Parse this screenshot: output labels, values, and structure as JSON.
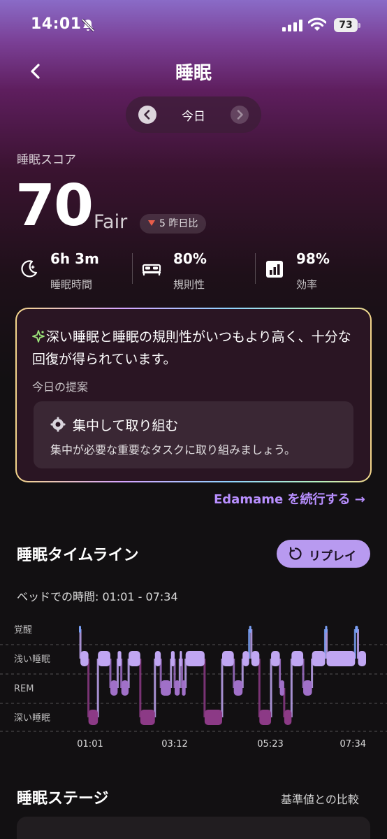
{
  "status_bar": {
    "time": "14:01",
    "battery": "73"
  },
  "header": {
    "title": "睡眠"
  },
  "date_nav": {
    "label": "今日"
  },
  "score": {
    "label": "睡眠スコア",
    "value": "70",
    "grade": "Fair",
    "delta_text": "5 昨日比"
  },
  "metrics": [
    {
      "value": "6h 3m",
      "label": "睡眠時間",
      "icon": "moon-icon"
    },
    {
      "value": "80%",
      "label": "規則性",
      "icon": "bed-icon"
    },
    {
      "value": "98%",
      "label": "効率",
      "icon": "efficiency-icon"
    }
  ],
  "insight": {
    "text": "深い睡眠と睡眠の規則性がいつもより高く、十分な回復が得られています。",
    "suggestion_label": "今日の提案",
    "suggestion_title": "集中して取り組む",
    "suggestion_desc": "集中が必要な重要なタスクに取り組みましょう。"
  },
  "continue_link": "Edamame を続行する →",
  "timeline": {
    "title": "睡眠タイムライン",
    "replay_label": "リプレイ",
    "bed_time": "ベッドでの時間: 01:01 - 07:34"
  },
  "stages": {
    "title": "睡眠ステージ",
    "compare_link": "基準値との比較"
  },
  "colors": {
    "accent": "#b89af0",
    "awake": "#7aa0f5",
    "light": "#c0a6f2",
    "rem": "#a070c8",
    "deep": "#8c3a86",
    "delta_down": "#e85d4a"
  },
  "chart_data": {
    "type": "hypnogram",
    "stages": [
      "覚醒",
      "浅い睡眠",
      "REM",
      "深い睡眠"
    ],
    "x_ticks": [
      "01:01",
      "03:12",
      "05:23",
      "07:34"
    ],
    "x_range_minutes": [
      0,
      393
    ],
    "segments": [
      {
        "stage": "覚醒",
        "start": 0,
        "end": 2
      },
      {
        "stage": "浅い睡眠",
        "start": 2,
        "end": 13
      },
      {
        "stage": "深い睡眠",
        "start": 13,
        "end": 26
      },
      {
        "stage": "浅い睡眠",
        "start": 26,
        "end": 43
      },
      {
        "stage": "REM",
        "start": 43,
        "end": 53
      },
      {
        "stage": "浅い睡眠",
        "start": 53,
        "end": 58
      },
      {
        "stage": "REM",
        "start": 58,
        "end": 68
      },
      {
        "stage": "浅い睡眠",
        "start": 68,
        "end": 84
      },
      {
        "stage": "深い睡眠",
        "start": 84,
        "end": 104
      },
      {
        "stage": "浅い睡眠",
        "start": 104,
        "end": 112
      },
      {
        "stage": "REM",
        "start": 112,
        "end": 126
      },
      {
        "stage": "浅い睡眠",
        "start": 126,
        "end": 131
      },
      {
        "stage": "REM",
        "start": 131,
        "end": 138
      },
      {
        "stage": "浅い睡眠",
        "start": 138,
        "end": 141
      },
      {
        "stage": "REM",
        "start": 141,
        "end": 146
      },
      {
        "stage": "浅い睡眠",
        "start": 146,
        "end": 172
      },
      {
        "stage": "深い睡眠",
        "start": 172,
        "end": 196
      },
      {
        "stage": "浅い睡眠",
        "start": 196,
        "end": 212
      },
      {
        "stage": "REM",
        "start": 212,
        "end": 224
      },
      {
        "stage": "浅い睡眠",
        "start": 224,
        "end": 233
      },
      {
        "stage": "覚醒",
        "start": 233,
        "end": 236
      },
      {
        "stage": "浅い睡眠",
        "start": 236,
        "end": 247
      },
      {
        "stage": "深い睡眠",
        "start": 247,
        "end": 263
      },
      {
        "stage": "浅い睡眠",
        "start": 263,
        "end": 275
      },
      {
        "stage": "REM",
        "start": 275,
        "end": 281
      },
      {
        "stage": "深い睡眠",
        "start": 281,
        "end": 291
      },
      {
        "stage": "浅い睡眠",
        "start": 291,
        "end": 307
      },
      {
        "stage": "REM",
        "start": 307,
        "end": 319
      },
      {
        "stage": "浅い睡眠",
        "start": 319,
        "end": 337
      },
      {
        "stage": "覚醒",
        "start": 337,
        "end": 339
      },
      {
        "stage": "浅い睡眠",
        "start": 339,
        "end": 378
      },
      {
        "stage": "覚醒",
        "start": 378,
        "end": 382
      },
      {
        "stage": "浅い睡眠",
        "start": 382,
        "end": 393
      }
    ]
  }
}
